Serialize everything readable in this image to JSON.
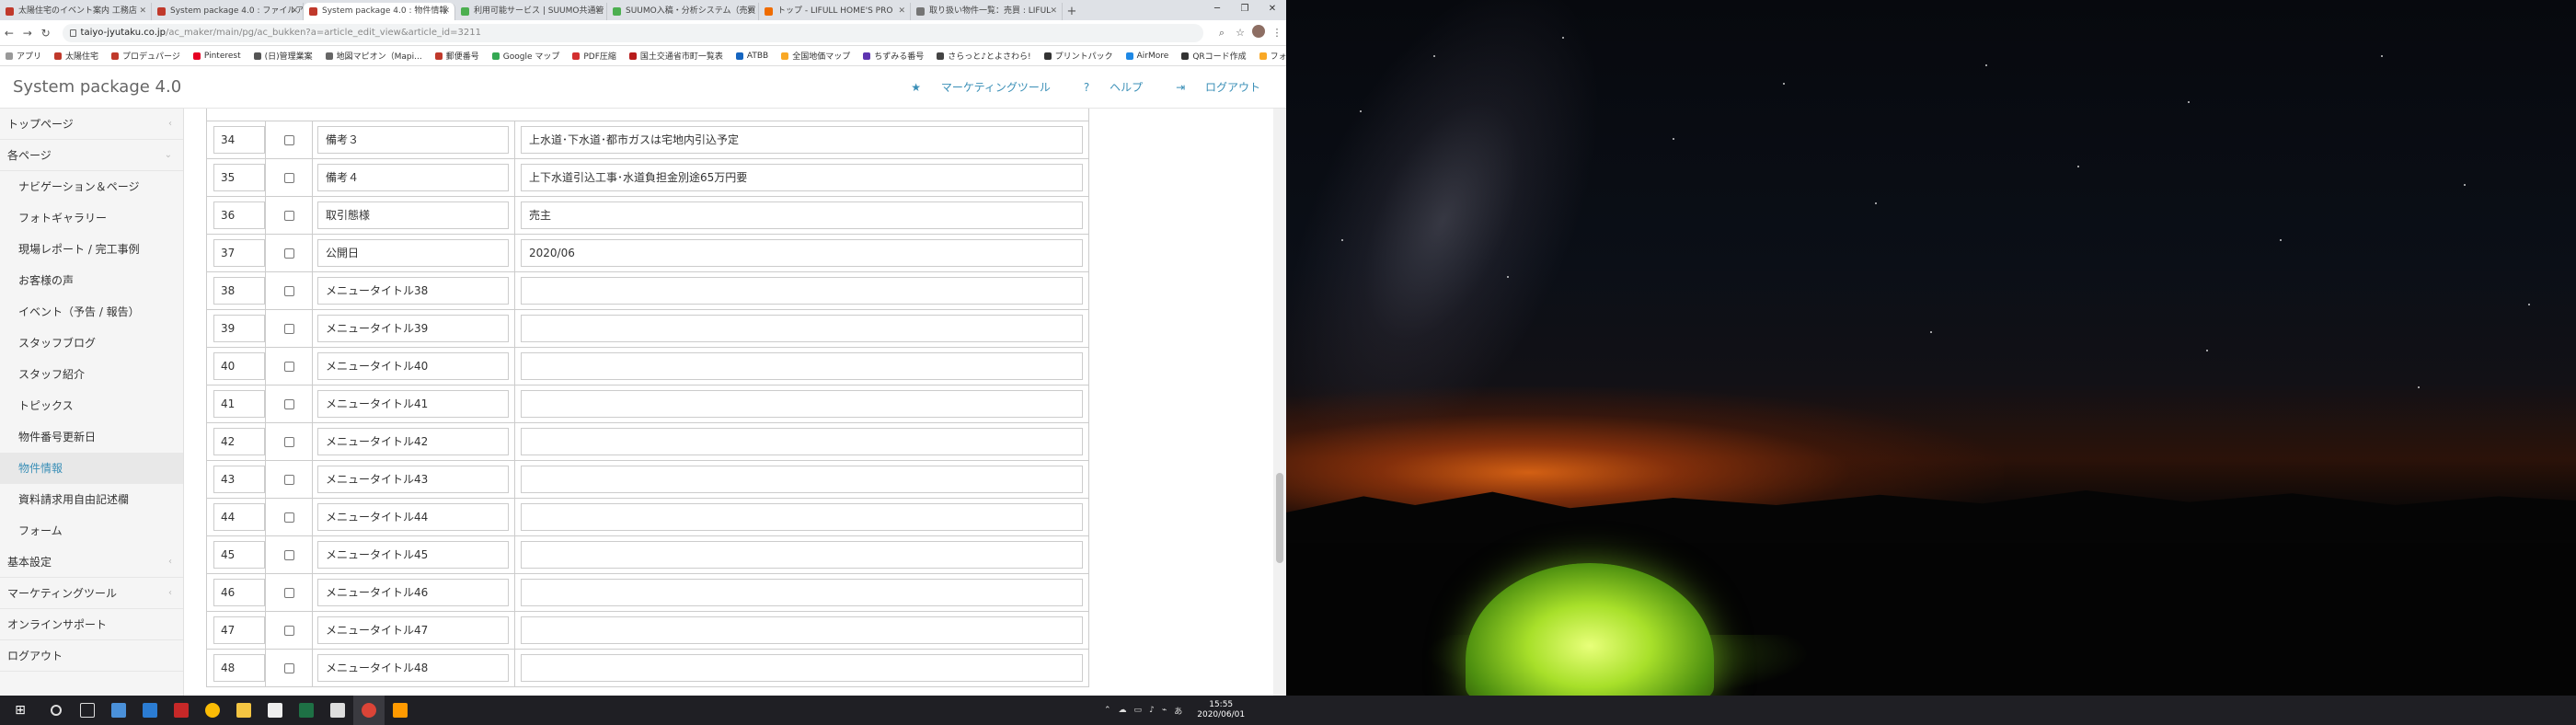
{
  "tabs": [
    {
      "title": "太陽住宅のイベント案内 工務店"
    },
    {
      "title": "System package 4.0 : ファイルア"
    },
    {
      "title": "System package 4.0 : 物件情報"
    },
    {
      "title": "利用可能サービス | SUUMO共通管"
    },
    {
      "title": "SUUMO入稿・分析システム（売買"
    },
    {
      "title": "トップ - LIFULL HOME'S PRO"
    },
    {
      "title": "取り扱い物件一覧：売買 : LIFUL"
    }
  ],
  "url": {
    "host": "taiyo-jyutaku.co.jp",
    "path": "/ac_maker/main/pg/ac_bukken?a=article_edit_view&article_id=3211"
  },
  "bookmarks": [
    "アプリ",
    "太陽住宅",
    "プロデュパージ",
    "Pinterest",
    "(日)管理業案",
    "地図マピオン（Mapi...",
    "郵便番号",
    "Google マップ",
    "PDF圧縮",
    "国土交通省市町一覧表",
    "ATBB",
    "全国地価マップ",
    "ちずみる番号",
    "さらっと♪とよさわら!",
    "プリントパック",
    "AirMore",
    "QRコード作成",
    "フォント"
  ],
  "header": {
    "title": "System package 4.0",
    "marketing": "マーケティングツール",
    "help": "ヘルプ",
    "logout": "ログアウト"
  },
  "sidebar": [
    {
      "label": "トップページ"
    },
    {
      "label": "各ページ"
    },
    {
      "label": "ナビゲーション＆ページ"
    },
    {
      "label": "フォトギャラリー"
    },
    {
      "label": "現場レポート / 完工事例"
    },
    {
      "label": "お客様の声"
    },
    {
      "label": "イベント（予告 / 報告）"
    },
    {
      "label": "スタッフブログ"
    },
    {
      "label": "スタッフ紹介"
    },
    {
      "label": "トピックス"
    },
    {
      "label": "物件番号更新日"
    },
    {
      "label": "物件情報"
    },
    {
      "label": "資料請求用自由記述欄"
    },
    {
      "label": "フォーム"
    },
    {
      "label": "基本設定"
    },
    {
      "label": "マーケティングツール"
    },
    {
      "label": "オンラインサポート"
    },
    {
      "label": "ログアウト"
    }
  ],
  "rows": [
    {
      "num": "34",
      "label": "備考３",
      "value": "上水道･下水道･都市ガスは宅地内引込予定"
    },
    {
      "num": "35",
      "label": "備考４",
      "value": "上下水道引込工事･水道負担金別途65万円要"
    },
    {
      "num": "36",
      "label": "取引態様",
      "value": "売主"
    },
    {
      "num": "37",
      "label": "公開日",
      "value": "2020/06"
    },
    {
      "num": "38",
      "label": "メニュータイトル38",
      "value": ""
    },
    {
      "num": "39",
      "label": "メニュータイトル39",
      "value": ""
    },
    {
      "num": "40",
      "label": "メニュータイトル40",
      "value": ""
    },
    {
      "num": "41",
      "label": "メニュータイトル41",
      "value": ""
    },
    {
      "num": "42",
      "label": "メニュータイトル42",
      "value": ""
    },
    {
      "num": "43",
      "label": "メニュータイトル43",
      "value": ""
    },
    {
      "num": "44",
      "label": "メニュータイトル44",
      "value": ""
    },
    {
      "num": "45",
      "label": "メニュータイトル45",
      "value": ""
    },
    {
      "num": "46",
      "label": "メニュータイトル46",
      "value": ""
    },
    {
      "num": "47",
      "label": "メニュータイトル47",
      "value": ""
    },
    {
      "num": "48",
      "label": "メニュータイトル48",
      "value": ""
    }
  ],
  "taskbar": {
    "ime": "あ",
    "time": "15:55",
    "date": "2020/06/01"
  },
  "colors": {
    "accent": "#3a8fb7",
    "taskbar": "#1f1f24"
  }
}
